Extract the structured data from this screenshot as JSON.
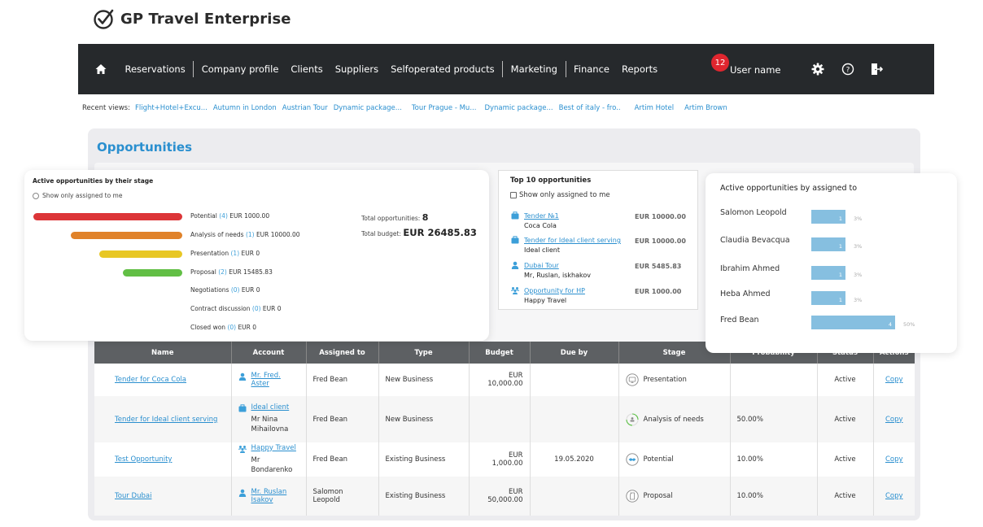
{
  "app": {
    "title": "GP Travel Enterprise"
  },
  "nav": {
    "items": [
      "Reservations",
      "Company profile",
      "Clients",
      "Suppliers",
      "Selfoperated products",
      "Marketing",
      "Finance",
      "Reports"
    ],
    "notifications_count": "12",
    "user_name": "User name",
    "icons": [
      "home-icon",
      "gear-icon",
      "help-icon",
      "logout-icon"
    ]
  },
  "recent": {
    "label": "Recent views:",
    "links": [
      "Flight+Hotel+Excu...",
      "Autumn in London",
      "Austrian Tour",
      "Dynamic package...",
      "Tour Prague - Mu...",
      "Dynamic package...",
      "Best of italy - fro..",
      "Artim Hotel",
      "Artim Brown"
    ]
  },
  "page": {
    "title": "Opportunities"
  },
  "stage_card": {
    "title": "Active opportunities by their stage",
    "radio_label": "Show only assigned to me",
    "stages": [
      {
        "name": "Potential",
        "count": "(4)",
        "amount": "EUR 1000.00",
        "color": "#dc3538",
        "share": 1.0
      },
      {
        "name": "Analysis of needs",
        "count": "(1)",
        "amount": "EUR 10000.00",
        "color": "#e0822a",
        "share": 0.75
      },
      {
        "name": "Presentation",
        "count": "(1)",
        "amount": "EUR 0",
        "color": "#e8c724",
        "share": 0.56
      },
      {
        "name": "Proposal",
        "count": "(2)",
        "amount": "EUR 15485.83",
        "color": "#62bf45",
        "share": 0.4
      },
      {
        "name": "Negotiations",
        "count": "(0)",
        "amount": "EUR 0",
        "color": "#cccccc",
        "share": 0
      },
      {
        "name": "Contract discussion",
        "count": "(0)",
        "amount": "EUR 0",
        "color": "#cccccc",
        "share": 0
      },
      {
        "name": "Closed won",
        "count": "(0)",
        "amount": "EUR 0",
        "color": "#cccccc",
        "share": 0
      }
    ],
    "total_opportunities_label": "Total opportunities:",
    "total_opportunities": "8",
    "total_budget_label": "Total budget:",
    "total_budget": "EUR 26485.83"
  },
  "top10": {
    "title": "Top 10 opportunities",
    "checkbox_label": "Show only assigned to me",
    "items": [
      {
        "icon": "briefcase-icon",
        "name": "Tender №1",
        "sub": "Coca Cola",
        "amount": "EUR 10000.00"
      },
      {
        "icon": "briefcase-icon",
        "name": "Tender for Ideal client serving",
        "sub": "Ideal client",
        "amount": "EUR 10000.00"
      },
      {
        "icon": "person-icon",
        "name": "Dubai Tour",
        "sub": "Mr, Ruslan, iskhakov",
        "amount": "EUR 5485.83"
      },
      {
        "icon": "group-icon",
        "name": "Opportunity for HP",
        "sub": "Happy Travel",
        "amount": "EUR 1000.00"
      }
    ]
  },
  "assigned_card": {
    "title": "Active opportunities by assigned to",
    "rows": [
      {
        "name": "Salomon Leopold",
        "value": "1",
        "pct": "3%",
        "pct_num": 3
      },
      {
        "name": "Claudia Bevacqua",
        "value": "1",
        "pct": "3%",
        "pct_num": 3
      },
      {
        "name": "Ibrahim Ahmed",
        "value": "1",
        "pct": "3%",
        "pct_num": 3
      },
      {
        "name": "Heba Ahmed",
        "value": "1",
        "pct": "3%",
        "pct_num": 3
      },
      {
        "name": "Fred Bean",
        "value": "4",
        "pct": "50%",
        "pct_num": 50
      }
    ]
  },
  "table": {
    "headers": [
      "Name",
      "Account",
      "Assigned to",
      "Type",
      "Budget",
      "Due by",
      "Stage",
      "Probability",
      "Status",
      "Actions"
    ],
    "rows": [
      {
        "name": "Tender for Coca Cola",
        "account_icon": "person-icon",
        "account": "Mr. Fred. Aster",
        "account_sub": "",
        "assigned": "Fred Bean",
        "type": "New Business",
        "budget_cur": "EUR",
        "budget_val": "10,000.00",
        "due": "",
        "stage_icon": "presentation-icon",
        "stage": "Presentation",
        "probability": "",
        "status": "Active",
        "action": "Copy"
      },
      {
        "name": "Tender for Ideal client serving",
        "account_icon": "briefcase-icon",
        "account": "Ideal client",
        "account_sub": "Mr Nina Mihailovna",
        "assigned": "Fred Bean",
        "type": "New Business",
        "budget_cur": "",
        "budget_val": "",
        "due": "",
        "stage_icon": "analysis-icon",
        "stage": "Analysis of needs",
        "probability": "50.00%",
        "status": "Active",
        "action": "Copy"
      },
      {
        "name": "Test Opportunity",
        "account_icon": "group-icon",
        "account": "Happy Travel",
        "account_sub": "Mr Bondarenko",
        "assigned": "Fred Bean",
        "type": "Existing Business",
        "budget_cur": "",
        "budget_val": "EUR 1,000.00",
        "due": "19.05.2020",
        "stage_icon": "handshake-icon",
        "stage": "Potential",
        "probability": "10.00%",
        "status": "Active",
        "action": "Copy"
      },
      {
        "name": "Tour Dubai",
        "account_icon": "person-icon",
        "account": "Mr. Ruslan Isakov",
        "account_sub": "",
        "assigned": "Salomon Leopold",
        "type": "Existing Business",
        "budget_cur": "EUR",
        "budget_val": "50,000.00",
        "due": "",
        "stage_icon": "document-icon",
        "stage": "Proposal",
        "probability": "10.00%",
        "status": "Active",
        "action": "Copy"
      }
    ]
  },
  "colors": {
    "accent": "#2a8fcf",
    "navbar": "#26292c",
    "badge": "#e0262f",
    "assigned_bar": "#86bfe0",
    "table_header": "#5d6063"
  }
}
